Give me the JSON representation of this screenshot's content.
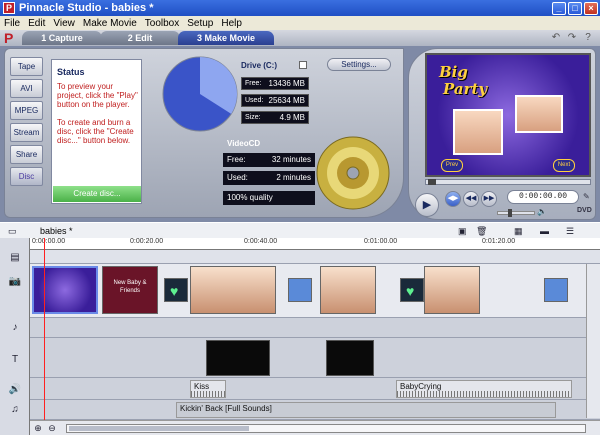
{
  "window": {
    "title": "Pinnacle Studio - babies *",
    "min": "_",
    "max": "□",
    "close": "×"
  },
  "menu": [
    "File",
    "Edit",
    "View",
    "Make Movie",
    "Toolbox",
    "Setup",
    "Help"
  ],
  "modes": [
    {
      "label": "1 Capture",
      "active": false
    },
    {
      "label": "2 Edit",
      "active": false
    },
    {
      "label": "3 Make Movie",
      "active": true
    }
  ],
  "formats": [
    "Tape",
    "AVI",
    "MPEG",
    "Stream",
    "Share",
    "Disc"
  ],
  "status": {
    "title": "Status",
    "msg1": "To preview your project, click the \"Play\" button on the player.",
    "msg2": "To create and burn a disc, click the \"Create disc...\" button below.",
    "create_label": "Create disc..."
  },
  "drive": {
    "label": "Drive (C:)",
    "settings_label": "Settings...",
    "rows": [
      {
        "k": "Free:",
        "v": "13436 MB"
      },
      {
        "k": "Used:",
        "v": "25634 MB"
      },
      {
        "k": "Size:",
        "v": "4.9 MB"
      }
    ],
    "used_fraction": 0.66
  },
  "videocd": {
    "label": "VideoCD",
    "rows": [
      {
        "k": "Free:",
        "v": "32 minutes"
      },
      {
        "k": "Used:",
        "v": "2 minutes"
      }
    ],
    "quality": "100% quality"
  },
  "preview": {
    "menu_title_1": "Big",
    "menu_title_2": "Party",
    "prev_label": "Prev",
    "next_label": "Next",
    "timecode": "0:00:00.00"
  },
  "timeline": {
    "project": "babies *",
    "ticks": [
      "0:00:00.00",
      "0:00:20.00",
      "0:00:40.00",
      "0:01:00.00",
      "0:01:20.00"
    ],
    "title_clip": "New Baby & Friends",
    "audio": [
      {
        "label": "Kiss"
      },
      {
        "label": "BabyCrying"
      }
    ],
    "music": "Kickin' Back [Full Sounds]"
  },
  "colors": {
    "accent": "#2a3f90",
    "create": "#4ab048",
    "status_text": "#c02020"
  }
}
